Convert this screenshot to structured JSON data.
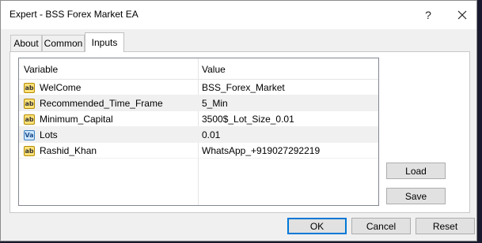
{
  "window": {
    "title": "Expert - BSS Forex Market EA",
    "help_glyph": "?"
  },
  "tabs": [
    {
      "label": "About"
    },
    {
      "label": "Common"
    },
    {
      "label": "Inputs"
    }
  ],
  "inputs_table": {
    "columns": [
      "Variable",
      "Value"
    ],
    "rows": [
      {
        "icon": "string-param-icon",
        "icon_text": "ab",
        "variable": "WelCome",
        "value": "BSS_Forex_Market"
      },
      {
        "icon": "string-param-icon",
        "icon_text": "ab",
        "variable": "Recommended_Time_Frame",
        "value": "5_Min"
      },
      {
        "icon": "string-param-icon",
        "icon_text": "ab",
        "variable": "Minimum_Capital",
        "value": "3500$_Lot_Size_0.01"
      },
      {
        "icon": "numeric-param-icon",
        "icon_text": "Va",
        "variable": "Lots",
        "value": "0.01"
      },
      {
        "icon": "string-param-icon",
        "icon_text": "ab",
        "variable": "Rashid_Khan",
        "value": "WhatsApp_+919027292219"
      }
    ]
  },
  "side_buttons": {
    "load": "Load",
    "save": "Save"
  },
  "footer_buttons": {
    "ok": "OK",
    "cancel": "Cancel",
    "reset": "Reset"
  }
}
